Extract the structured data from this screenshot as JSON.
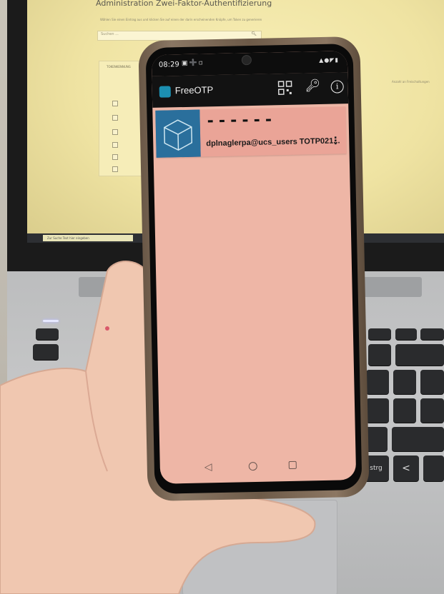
{
  "background_monitor": {
    "title": "Administration Zwei-Faktor-Authentifizierung",
    "description": "Wählen Sie einen Eintrag aus und klicken Sie auf einen der darin erscheinenden Knöpfe, um Token zu generieren",
    "search_label": "Suchen ...",
    "table_header": "TOKENKENNUNG",
    "right_column_label": "Anzahl an Freischaltungen",
    "taskbar_search": "Zur Suche Text hier eingeben"
  },
  "phone": {
    "status_bar": {
      "time": "08:29"
    },
    "app_bar": {
      "title": "FreeOTP"
    },
    "token": {
      "code": "------",
      "label": "dplnaglerpa@ucs_users TOTP021..."
    }
  },
  "keyboard": {
    "keys": [
      "strg"
    ]
  },
  "colors": {
    "screen_background": "#eeb6a6",
    "card_background": "#eaa497",
    "app_bar": "#121212",
    "monitor_screen": "#f3e9ab"
  }
}
